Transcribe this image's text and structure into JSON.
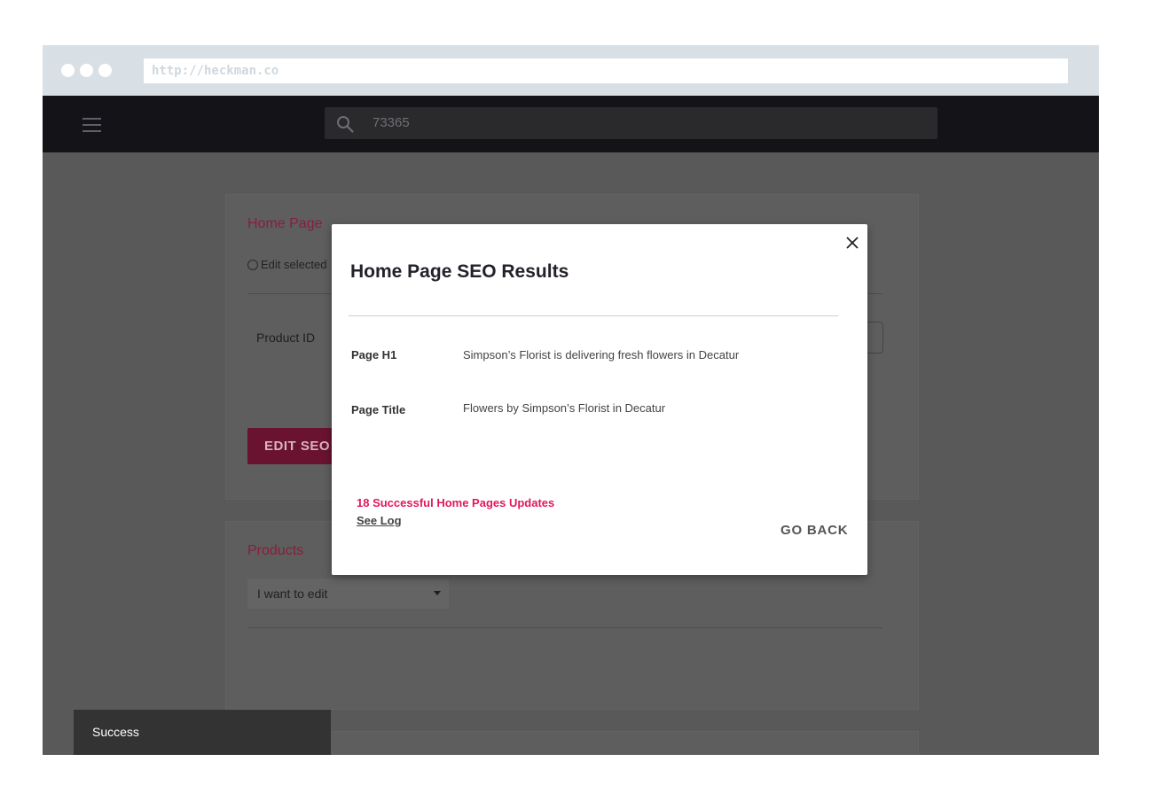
{
  "browser": {
    "url": "http://heckman.co"
  },
  "appbar": {
    "search_value": "73365"
  },
  "home_page_card": {
    "title": "Home Page",
    "radio_label": "Edit selected",
    "product_id_label": "Product ID",
    "edit_button_label": "EDIT SEO I"
  },
  "products_card": {
    "title": "Products",
    "select_value": "I want to edit"
  },
  "snackbar": {
    "message": "Success"
  },
  "modal": {
    "title": "Home Page SEO Results",
    "rows": [
      {
        "label": "Page H1",
        "value": "Simpson’s Florist is delivering fresh flowers in Decatur"
      },
      {
        "label": "Page Title",
        "value": "Flowers by Simpson’s Florist in Decatur"
      }
    ],
    "success_count_text": "18 Successful Home Pages Updates",
    "see_log_label": "See Log",
    "go_back_label": "GO BACK"
  },
  "colors": {
    "accent": "#e0195a",
    "appbar_bg": "#141418",
    "overlay_bg": "#595959"
  }
}
